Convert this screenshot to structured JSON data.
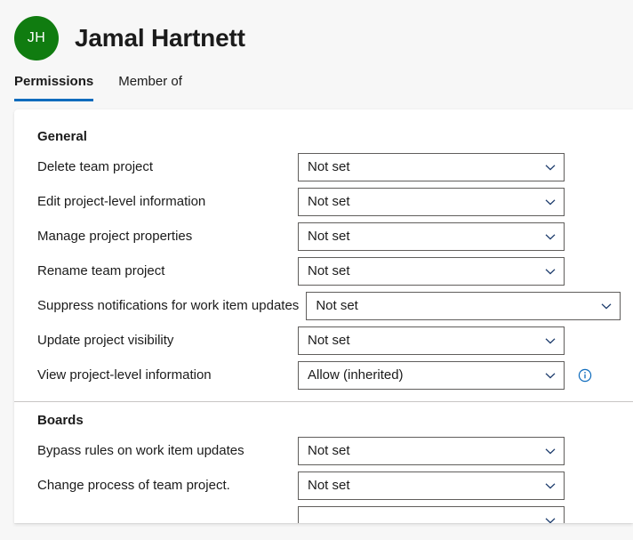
{
  "header": {
    "avatar_initials": "JH",
    "avatar_color": "#107c10",
    "display_name": "Jamal Hartnett"
  },
  "tabs": [
    {
      "label": "Permissions",
      "selected": true
    },
    {
      "label": "Member of",
      "selected": false
    }
  ],
  "accent_color": "#0f6cbd",
  "icons": {
    "chevron_down": "chevron-down-icon",
    "info": "info-icon"
  },
  "sections": [
    {
      "title": "General",
      "rows": [
        {
          "label": "Delete team project",
          "value": "Not set",
          "wide": false,
          "info": false
        },
        {
          "label": "Edit project-level information",
          "value": "Not set",
          "wide": false,
          "info": false
        },
        {
          "label": "Manage project properties",
          "value": "Not set",
          "wide": false,
          "info": false
        },
        {
          "label": "Rename team project",
          "value": "Not set",
          "wide": false,
          "info": false
        },
        {
          "label": "Suppress notifications for work item updates",
          "value": "Not set",
          "wide": true,
          "info": false
        },
        {
          "label": "Update project visibility",
          "value": "Not set",
          "wide": false,
          "info": false
        },
        {
          "label": "View project-level information",
          "value": "Allow (inherited)",
          "wide": false,
          "info": true
        }
      ]
    },
    {
      "title": "Boards",
      "rows": [
        {
          "label": "Bypass rules on work item updates",
          "value": "Not set",
          "wide": false,
          "info": false
        },
        {
          "label": "Change process of team project.",
          "value": "Not set",
          "wide": false,
          "info": false
        },
        {
          "label": "",
          "value": "",
          "wide": false,
          "info": false
        }
      ]
    }
  ]
}
